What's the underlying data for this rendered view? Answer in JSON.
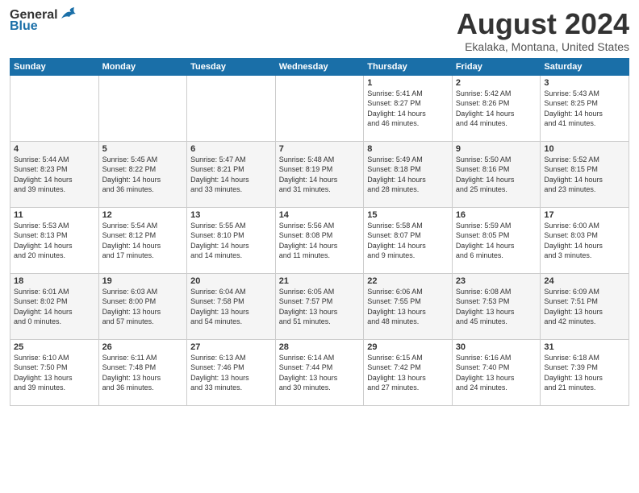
{
  "header": {
    "logo_general": "General",
    "logo_blue": "Blue",
    "title": "August 2024",
    "location": "Ekalaka, Montana, United States"
  },
  "weekdays": [
    "Sunday",
    "Monday",
    "Tuesday",
    "Wednesday",
    "Thursday",
    "Friday",
    "Saturday"
  ],
  "weeks": [
    [
      {
        "day": "",
        "info": ""
      },
      {
        "day": "",
        "info": ""
      },
      {
        "day": "",
        "info": ""
      },
      {
        "day": "",
        "info": ""
      },
      {
        "day": "1",
        "info": "Sunrise: 5:41 AM\nSunset: 8:27 PM\nDaylight: 14 hours\nand 46 minutes."
      },
      {
        "day": "2",
        "info": "Sunrise: 5:42 AM\nSunset: 8:26 PM\nDaylight: 14 hours\nand 44 minutes."
      },
      {
        "day": "3",
        "info": "Sunrise: 5:43 AM\nSunset: 8:25 PM\nDaylight: 14 hours\nand 41 minutes."
      }
    ],
    [
      {
        "day": "4",
        "info": "Sunrise: 5:44 AM\nSunset: 8:23 PM\nDaylight: 14 hours\nand 39 minutes."
      },
      {
        "day": "5",
        "info": "Sunrise: 5:45 AM\nSunset: 8:22 PM\nDaylight: 14 hours\nand 36 minutes."
      },
      {
        "day": "6",
        "info": "Sunrise: 5:47 AM\nSunset: 8:21 PM\nDaylight: 14 hours\nand 33 minutes."
      },
      {
        "day": "7",
        "info": "Sunrise: 5:48 AM\nSunset: 8:19 PM\nDaylight: 14 hours\nand 31 minutes."
      },
      {
        "day": "8",
        "info": "Sunrise: 5:49 AM\nSunset: 8:18 PM\nDaylight: 14 hours\nand 28 minutes."
      },
      {
        "day": "9",
        "info": "Sunrise: 5:50 AM\nSunset: 8:16 PM\nDaylight: 14 hours\nand 25 minutes."
      },
      {
        "day": "10",
        "info": "Sunrise: 5:52 AM\nSunset: 8:15 PM\nDaylight: 14 hours\nand 23 minutes."
      }
    ],
    [
      {
        "day": "11",
        "info": "Sunrise: 5:53 AM\nSunset: 8:13 PM\nDaylight: 14 hours\nand 20 minutes."
      },
      {
        "day": "12",
        "info": "Sunrise: 5:54 AM\nSunset: 8:12 PM\nDaylight: 14 hours\nand 17 minutes."
      },
      {
        "day": "13",
        "info": "Sunrise: 5:55 AM\nSunset: 8:10 PM\nDaylight: 14 hours\nand 14 minutes."
      },
      {
        "day": "14",
        "info": "Sunrise: 5:56 AM\nSunset: 8:08 PM\nDaylight: 14 hours\nand 11 minutes."
      },
      {
        "day": "15",
        "info": "Sunrise: 5:58 AM\nSunset: 8:07 PM\nDaylight: 14 hours\nand 9 minutes."
      },
      {
        "day": "16",
        "info": "Sunrise: 5:59 AM\nSunset: 8:05 PM\nDaylight: 14 hours\nand 6 minutes."
      },
      {
        "day": "17",
        "info": "Sunrise: 6:00 AM\nSunset: 8:03 PM\nDaylight: 14 hours\nand 3 minutes."
      }
    ],
    [
      {
        "day": "18",
        "info": "Sunrise: 6:01 AM\nSunset: 8:02 PM\nDaylight: 14 hours\nand 0 minutes."
      },
      {
        "day": "19",
        "info": "Sunrise: 6:03 AM\nSunset: 8:00 PM\nDaylight: 13 hours\nand 57 minutes."
      },
      {
        "day": "20",
        "info": "Sunrise: 6:04 AM\nSunset: 7:58 PM\nDaylight: 13 hours\nand 54 minutes."
      },
      {
        "day": "21",
        "info": "Sunrise: 6:05 AM\nSunset: 7:57 PM\nDaylight: 13 hours\nand 51 minutes."
      },
      {
        "day": "22",
        "info": "Sunrise: 6:06 AM\nSunset: 7:55 PM\nDaylight: 13 hours\nand 48 minutes."
      },
      {
        "day": "23",
        "info": "Sunrise: 6:08 AM\nSunset: 7:53 PM\nDaylight: 13 hours\nand 45 minutes."
      },
      {
        "day": "24",
        "info": "Sunrise: 6:09 AM\nSunset: 7:51 PM\nDaylight: 13 hours\nand 42 minutes."
      }
    ],
    [
      {
        "day": "25",
        "info": "Sunrise: 6:10 AM\nSunset: 7:50 PM\nDaylight: 13 hours\nand 39 minutes."
      },
      {
        "day": "26",
        "info": "Sunrise: 6:11 AM\nSunset: 7:48 PM\nDaylight: 13 hours\nand 36 minutes."
      },
      {
        "day": "27",
        "info": "Sunrise: 6:13 AM\nSunset: 7:46 PM\nDaylight: 13 hours\nand 33 minutes."
      },
      {
        "day": "28",
        "info": "Sunrise: 6:14 AM\nSunset: 7:44 PM\nDaylight: 13 hours\nand 30 minutes."
      },
      {
        "day": "29",
        "info": "Sunrise: 6:15 AM\nSunset: 7:42 PM\nDaylight: 13 hours\nand 27 minutes."
      },
      {
        "day": "30",
        "info": "Sunrise: 6:16 AM\nSunset: 7:40 PM\nDaylight: 13 hours\nand 24 minutes."
      },
      {
        "day": "31",
        "info": "Sunrise: 6:18 AM\nSunset: 7:39 PM\nDaylight: 13 hours\nand 21 minutes."
      }
    ]
  ]
}
